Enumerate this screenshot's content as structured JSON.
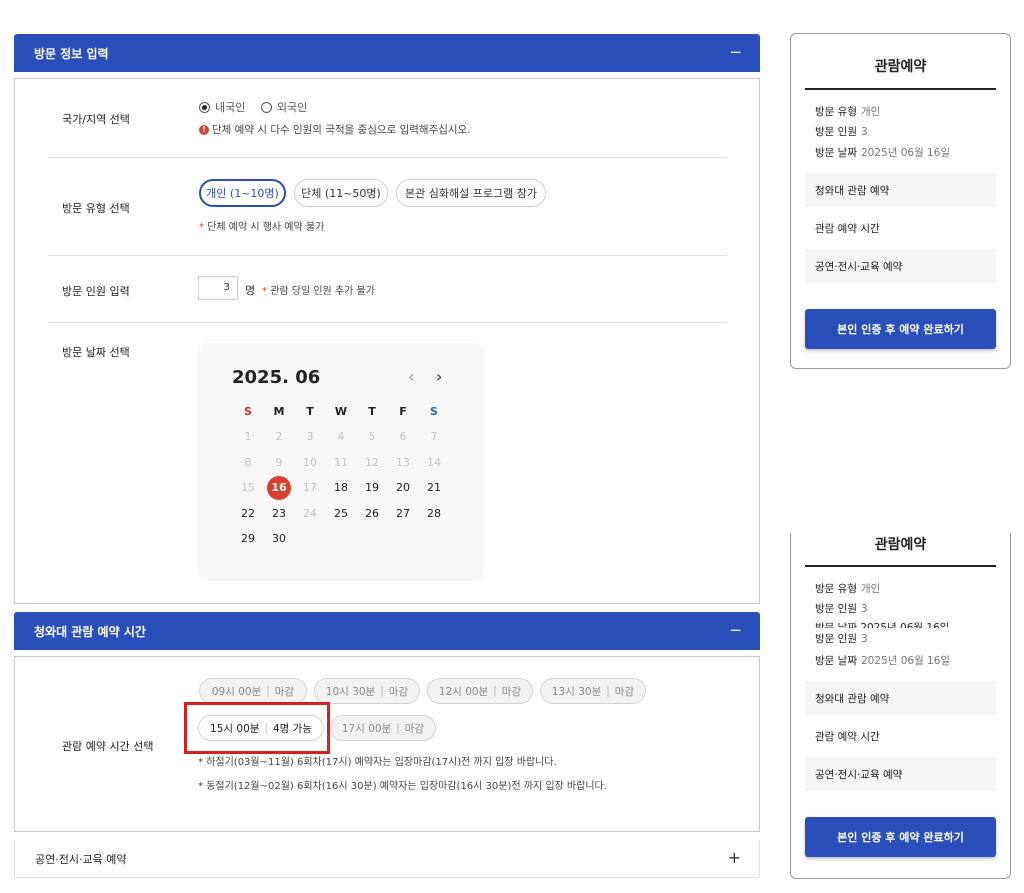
{
  "visit_info": {
    "header": "방문 정보 입력",
    "toggle": "−",
    "country": {
      "label": "국가/지역 선택",
      "options": [
        "내국인",
        "외국인"
      ],
      "notice": "단체 예약 시 다수 인원의 국적을 중심으로 입력해주십시오."
    },
    "type": {
      "label": "방문 유형 선택",
      "options": [
        "개인 (1~10명)",
        "단체 (11~50명)",
        "본관 심화해설 프로그램 참가"
      ],
      "note": "단체 예약 시 행사 예약 불가"
    },
    "count": {
      "label": "방문 인원 입력",
      "value": "3",
      "unit": "명",
      "note": "관람 당일 인원 추가 불가"
    },
    "date": {
      "label": "방문 날짜 선택",
      "calendar": {
        "title": "2025. 06",
        "prev": "‹",
        "next": "›",
        "weekdays": [
          "S",
          "M",
          "T",
          "W",
          "T",
          "F",
          "S"
        ],
        "weeks": [
          [
            "1",
            "2",
            "3",
            "4",
            "5",
            "6",
            "7"
          ],
          [
            "8",
            "9",
            "10",
            "11",
            "12",
            "13",
            "14"
          ],
          [
            "15",
            "16",
            "17",
            "18",
            "19",
            "20",
            "21"
          ],
          [
            "22",
            "23",
            "24",
            "25",
            "26",
            "27",
            "28"
          ],
          [
            "29",
            "30",
            "",
            "",
            "",
            "",
            ""
          ]
        ],
        "selected": "16"
      }
    }
  },
  "time_section": {
    "header": "청와대 관람 예약 시간",
    "toggle": "−",
    "label": "관람 예약 시간 선택",
    "slots": [
      {
        "time": "09시 00분",
        "status": "마감"
      },
      {
        "time": "10시 30분",
        "status": "마감"
      },
      {
        "time": "12시 00분",
        "status": "마감"
      },
      {
        "time": "13시 30분",
        "status": "마감"
      },
      {
        "time": "15시 00분",
        "status": "4명 가능"
      },
      {
        "time": "17시 00분",
        "status": "마감"
      }
    ],
    "notes": [
      "하절기(03월~11월) 6회차(17시) 예약자는 입장마감(17시)전 까지 입장 바랍니다.",
      "동절기(12월~02월) 6회차(16시 30분) 예약자는 입장마감(16시 30분)전 까지 입장 바랍니다."
    ]
  },
  "performance_section": {
    "header": "공연·전시·교육 예약",
    "toggle": "+"
  },
  "summary": {
    "title": "관람예약",
    "type_label": "방문 유형",
    "type_value": "개인",
    "count_label": "방문 인원",
    "count_value": "3",
    "date_label": "방문 날짜",
    "date_value": "2025년 06월 16일",
    "items": [
      "청와대 관람 예약",
      "관람 예약 시간",
      "공연·전시·교육 예약"
    ],
    "button": "본인 인증 후 예약 완료하기"
  },
  "summary_overlap": {
    "partial_date_text": "방문 날짜  2025년 06월 16일"
  },
  "colors": {
    "primary": "#2b4fba",
    "accent_red": "#d6422f",
    "highlight": "#d42020"
  }
}
